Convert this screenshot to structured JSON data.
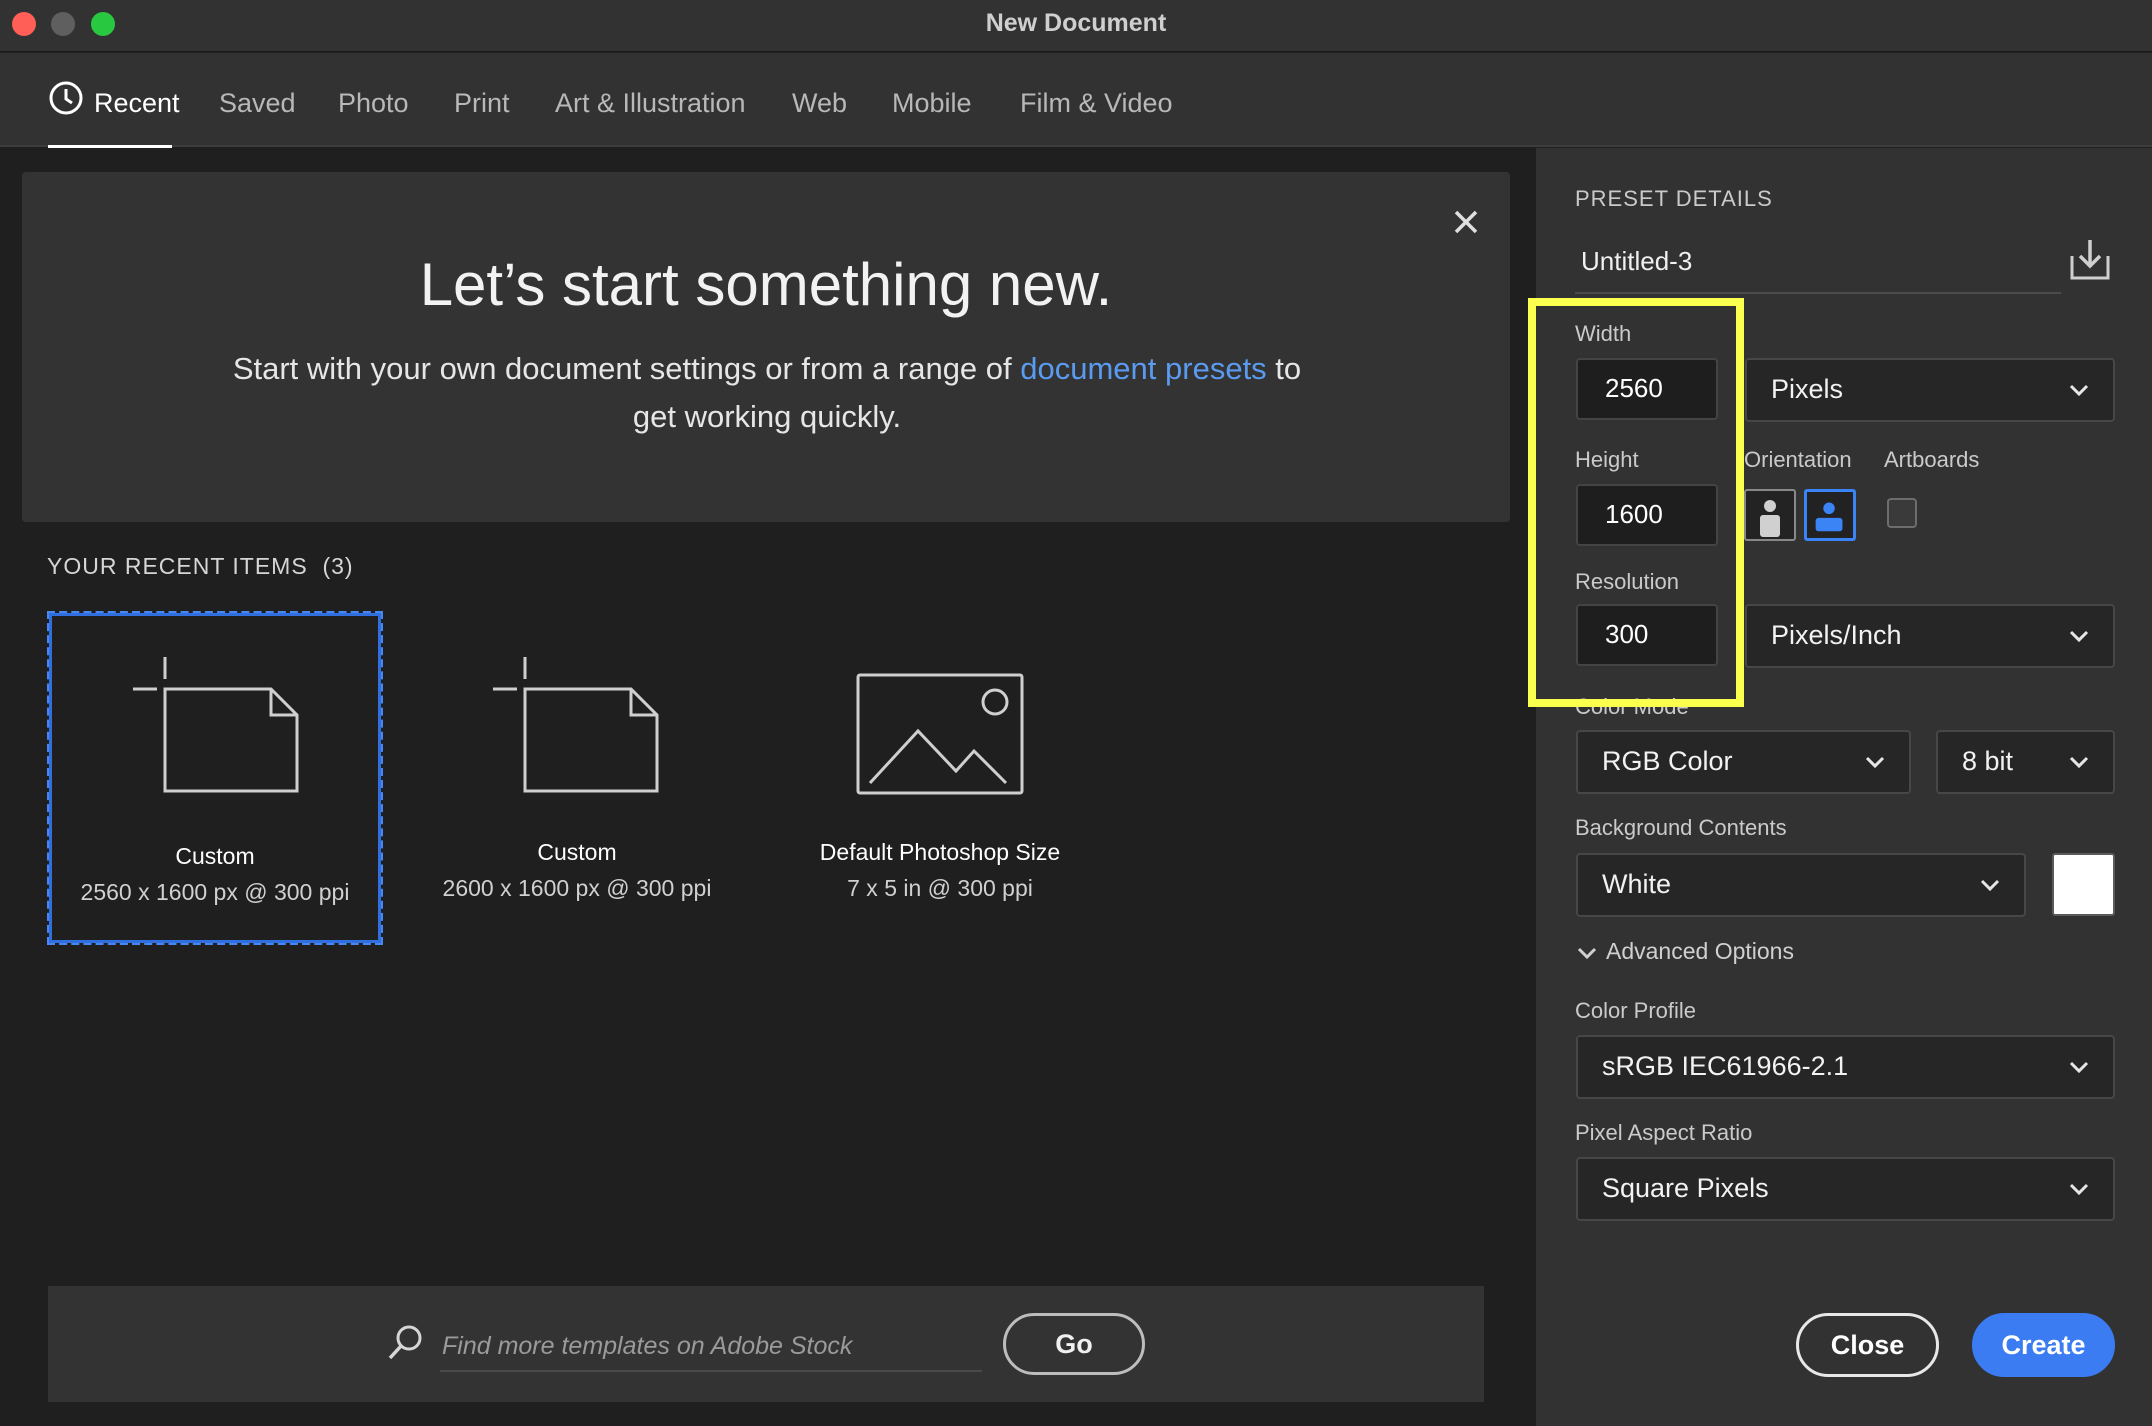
{
  "window": {
    "title": "New Document"
  },
  "tabs": [
    {
      "label": "Recent"
    },
    {
      "label": "Saved"
    },
    {
      "label": "Photo"
    },
    {
      "label": "Print"
    },
    {
      "label": "Art & Illustration"
    },
    {
      "label": "Web"
    },
    {
      "label": "Mobile"
    },
    {
      "label": "Film & Video"
    }
  ],
  "hero": {
    "title": "Let’s start something new.",
    "text_before": "Start with your own document settings or from a range of ",
    "link": "document presets",
    "text_after": " to get working quickly."
  },
  "recent": {
    "heading": "YOUR RECENT ITEMS",
    "count": "(3)",
    "items": [
      {
        "title": "Custom",
        "sub": "2560 x 1600 px @ 300 ppi",
        "icon": "new-document-icon"
      },
      {
        "title": "Custom",
        "sub": "2600 x 1600 px @ 300 ppi",
        "icon": "new-document-icon"
      },
      {
        "title": "Default Photoshop Size",
        "sub": "7 x 5 in @ 300 ppi",
        "icon": "image-icon"
      }
    ]
  },
  "stock": {
    "placeholder": "Find more templates on Adobe Stock",
    "go_label": "Go"
  },
  "preset": {
    "heading": "PRESET DETAILS",
    "name": "Untitled-3",
    "width_label": "Width",
    "width": "2560",
    "width_unit": "Pixels",
    "height_label": "Height",
    "height": "1600",
    "orientation_label": "Orientation",
    "artboards_label": "Artboards",
    "resolution_label": "Resolution",
    "resolution": "300",
    "resolution_unit": "Pixels/Inch",
    "color_mode_label": "Color Mode",
    "color_mode": "RGB Color",
    "bit_depth": "8 bit",
    "background_label": "Background Contents",
    "background": "White",
    "background_swatch": "#ffffff",
    "advanced_label": "Advanced Options",
    "color_profile_label": "Color Profile",
    "color_profile": "sRGB IEC61966-2.1",
    "pixel_aspect_label": "Pixel Aspect Ratio",
    "pixel_aspect": "Square Pixels"
  },
  "actions": {
    "close": "Close",
    "create": "Create"
  },
  "colors": {
    "accent": "#3b7cf2",
    "highlight": "#fbff4e",
    "link": "#5a9bf0"
  }
}
